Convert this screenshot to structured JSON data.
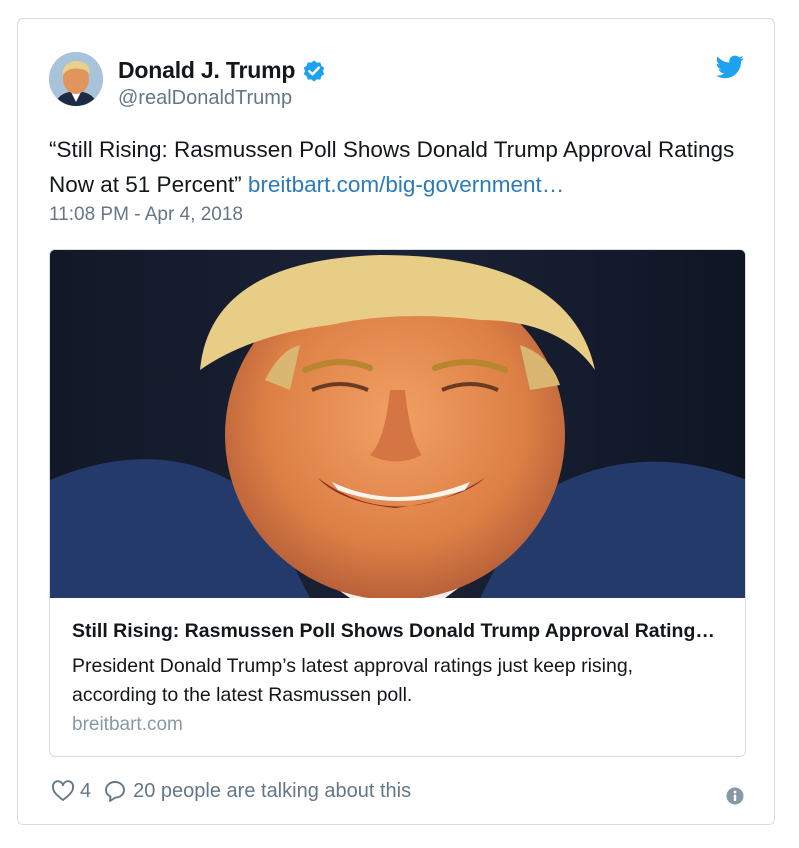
{
  "author": {
    "name": "Donald J. Trump",
    "handle": "@realDonaldTrump"
  },
  "tweet": {
    "text": "“Still Rising: Rasmussen Poll Shows Donald Trump Approval Ratings Now at 51 Percent”",
    "link_text": "breitbart.com/big-government…",
    "timestamp": "11:08 PM - Apr 4, 2018"
  },
  "card": {
    "title": "Still Rising: Rasmussen Poll Shows Donald Trump Approval Rating…",
    "description": "President Donald Trump’s latest approval ratings just keep rising, according to the latest Rasmussen poll.",
    "domain": "breitbart.com"
  },
  "footer": {
    "like_count": "4",
    "talking_text": "20 people are talking about this"
  },
  "icons": {
    "verified": "verified-badge-icon",
    "bird": "twitter-bird-icon",
    "like": "heart-icon",
    "reply": "speech-bubble-icon",
    "info": "info-icon"
  },
  "colors": {
    "link": "#2b7bb9",
    "secondary_text": "#657786",
    "brand": "#1da1f2",
    "border": "#d7dde2"
  }
}
